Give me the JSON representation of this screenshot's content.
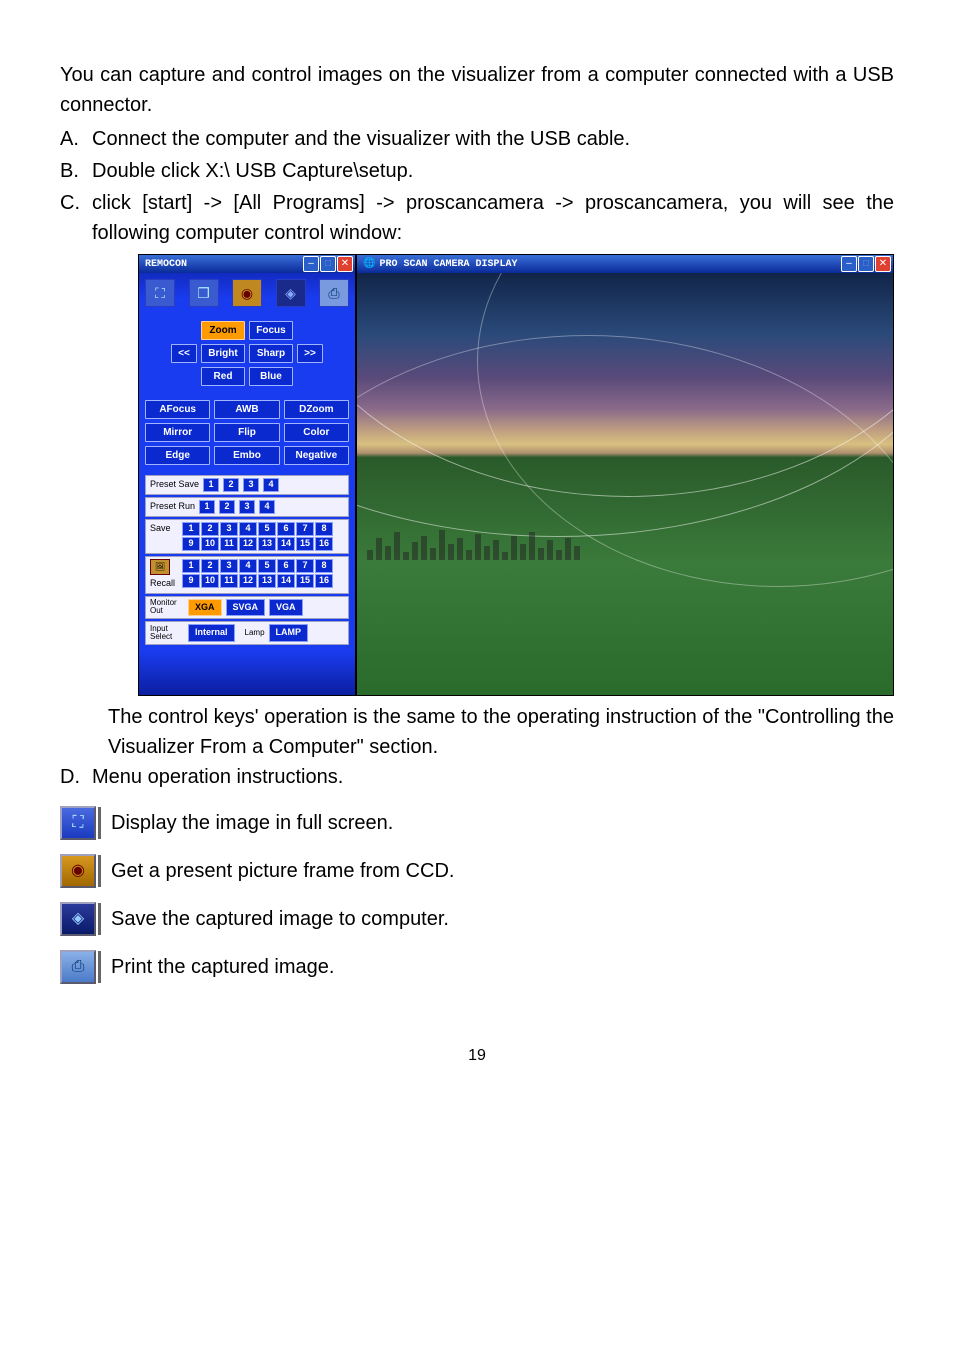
{
  "intro": "You can capture and control images on the visualizer from a computer connected with a USB connector.",
  "steps": {
    "A": "Connect the computer and the visualizer with the USB cable.",
    "B": "Double click X:\\ USB Capture\\setup.",
    "C": "click [start] -> [All Programs] -> proscancamera -> proscancamera, you will see the following computer control window:",
    "C_after": "The control keys' operation is the same to the operating instruction of the \"Controlling the Visualizer From a Computer\" section.",
    "D": "Menu operation instructions."
  },
  "remocon": {
    "title": "REMOCON",
    "controls": {
      "left": "<<",
      "right": ">>",
      "zoom": "Zoom",
      "focus": "Focus",
      "bright": "Bright",
      "sharp": "Sharp",
      "red": "Red",
      "blue": "Blue"
    },
    "functions": [
      "AFocus",
      "AWB",
      "DZoom",
      "Mirror",
      "Flip",
      "Color",
      "Edge",
      "Embo",
      "Negative"
    ],
    "preset_save": "Preset Save",
    "preset_run": "Preset Run",
    "save": "Save",
    "recall": "Recall",
    "preset_nums": [
      "1",
      "2",
      "3",
      "4"
    ],
    "save_nums_1": [
      "1",
      "2",
      "3",
      "4",
      "5",
      "6",
      "7",
      "8"
    ],
    "save_nums_2": [
      "9",
      "10",
      "11",
      "12",
      "13",
      "14",
      "15",
      "16"
    ],
    "monitor_out": {
      "label": "Monitor Out",
      "options": [
        "XGA",
        "SVGA",
        "VGA"
      ],
      "selected": "XGA"
    },
    "input_select": {
      "label": "Input Select",
      "value": "Internal"
    },
    "lamp": {
      "label": "Lamp",
      "value": "LAMP"
    }
  },
  "display": {
    "title": "PRO SCAN CAMERA DISPLAY"
  },
  "menu": [
    {
      "id": "fullscreen",
      "text": "Display the image in full screen."
    },
    {
      "id": "capture",
      "text": "Get a present picture frame from CCD."
    },
    {
      "id": "save",
      "text": "Save the captured image to computer."
    },
    {
      "id": "print",
      "text": "Print the captured image."
    }
  ],
  "page_number": "19"
}
